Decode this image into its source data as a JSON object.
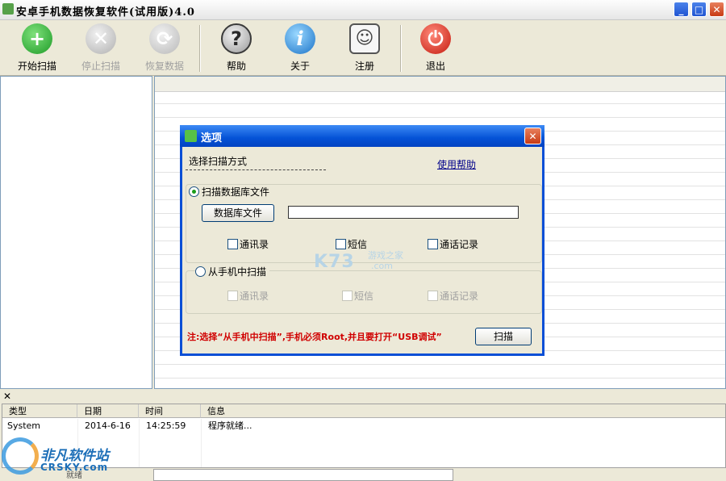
{
  "window": {
    "title": "安卓手机数据恢复软件(试用版)4.0",
    "buttons": {
      "minimize": "_",
      "maximize": "□",
      "close": "✕"
    }
  },
  "toolbar": {
    "buttons": [
      {
        "label": "开始扫描",
        "icon": "plus-icon",
        "glyph": "+",
        "enabled": true
      },
      {
        "label": "停止扫描",
        "icon": "stop-icon",
        "glyph": "✕",
        "enabled": false
      },
      {
        "label": "恢复数据",
        "icon": "refresh-icon",
        "glyph": "⟳",
        "enabled": false
      },
      {
        "label": "帮助",
        "icon": "help-icon",
        "glyph": "?",
        "enabled": true
      },
      {
        "label": "关于",
        "icon": "info-icon",
        "glyph": "i",
        "enabled": true
      },
      {
        "label": "注册",
        "icon": "user-icon",
        "glyph": "☺",
        "enabled": true
      },
      {
        "label": "退出",
        "icon": "power-icon",
        "glyph": "⏻",
        "enabled": true
      }
    ]
  },
  "dialog": {
    "title": "选项",
    "close": "✕",
    "choose_label": "选择扫描方式",
    "help_link": "使用帮助",
    "option_db": {
      "label": "扫描数据库文件",
      "selected": true,
      "button": "数据库文件",
      "path_value": "",
      "checkboxes": [
        {
          "label": "通讯录",
          "checked": false,
          "enabled": true
        },
        {
          "label": "短信",
          "checked": false,
          "enabled": true
        },
        {
          "label": "通话记录",
          "checked": false,
          "enabled": true
        }
      ]
    },
    "option_phone": {
      "label": "从手机中扫描",
      "selected": false,
      "checkboxes": [
        {
          "label": "通讯录",
          "checked": false,
          "enabled": false
        },
        {
          "label": "短信",
          "checked": false,
          "enabled": false
        },
        {
          "label": "通话记录",
          "checked": false,
          "enabled": false
        }
      ]
    },
    "note": "注:选择“从手机中扫描”,手机必须Root,并且要打开“USB调试”",
    "scan_button": "扫描",
    "watermark": {
      "main": "K73",
      "sub1": "游戏之家",
      "sub2": ".com"
    }
  },
  "log": {
    "close": "✕",
    "columns": [
      "类型",
      "日期",
      "时间",
      "信息"
    ],
    "rows": [
      {
        "type": "System",
        "date": "2014-6-16",
        "time": "14:25:59",
        "info": "程序就绪..."
      }
    ]
  },
  "statusbar": {
    "text": "就绪"
  },
  "watermark": {
    "name": "非凡软件站",
    "domain": "CRSKY.com"
  },
  "colors": {
    "dialog_border": "#0a4fd6",
    "note_red": "#d00000",
    "link": "#00008b",
    "start_green": "#1e9b28",
    "exit_red": "#c41a0e"
  }
}
